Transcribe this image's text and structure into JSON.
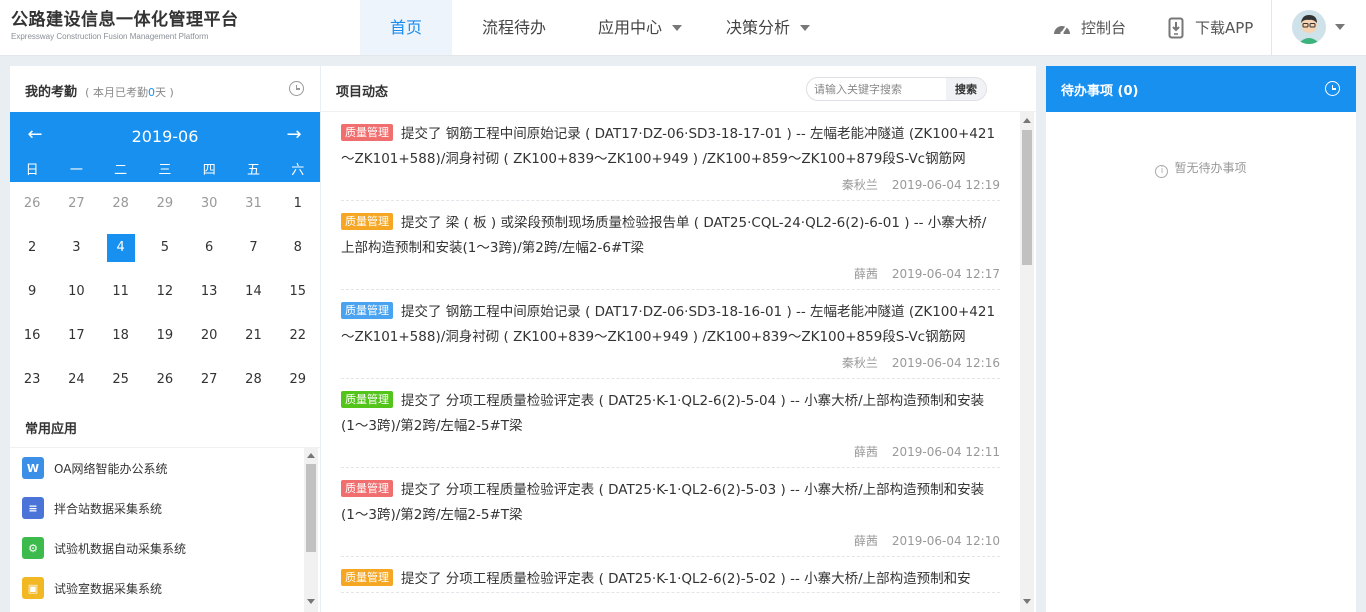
{
  "brand": {
    "title_cn": "公路建设信息一体化管理平台",
    "title_en": "Expressway Construction Fusion Management Platform"
  },
  "nav": [
    {
      "label": "首页",
      "active": true
    },
    {
      "label": "流程待办"
    },
    {
      "label": "应用中心",
      "dropdown": true
    },
    {
      "label": "决策分析",
      "dropdown": true
    }
  ],
  "header_right": {
    "console_label": "控制台",
    "download_label": "下载APP"
  },
  "attendance": {
    "title": "我的考勤",
    "subtitle_prefix": "( 本月已考勤",
    "count": "0",
    "subtitle_suffix": "天 )"
  },
  "calendar": {
    "month": "2019-06",
    "prev_icon": "←",
    "next_icon": "→",
    "weekdays": [
      "日",
      "一",
      "二",
      "三",
      "四",
      "五",
      "六"
    ],
    "weeks": [
      [
        {
          "d": "26",
          "muted": true
        },
        {
          "d": "27",
          "muted": true
        },
        {
          "d": "28",
          "muted": true
        },
        {
          "d": "29",
          "muted": true
        },
        {
          "d": "30",
          "muted": true
        },
        {
          "d": "31",
          "muted": true
        },
        {
          "d": "1"
        }
      ],
      [
        {
          "d": "2"
        },
        {
          "d": "3"
        },
        {
          "d": "4",
          "today": true
        },
        {
          "d": "5"
        },
        {
          "d": "6"
        },
        {
          "d": "7"
        },
        {
          "d": "8"
        }
      ],
      [
        {
          "d": "9"
        },
        {
          "d": "10"
        },
        {
          "d": "11"
        },
        {
          "d": "12"
        },
        {
          "d": "13"
        },
        {
          "d": "14"
        },
        {
          "d": "15"
        }
      ],
      [
        {
          "d": "16"
        },
        {
          "d": "17"
        },
        {
          "d": "18"
        },
        {
          "d": "19"
        },
        {
          "d": "20"
        },
        {
          "d": "21"
        },
        {
          "d": "22"
        }
      ],
      [
        {
          "d": "23"
        },
        {
          "d": "24"
        },
        {
          "d": "25"
        },
        {
          "d": "26"
        },
        {
          "d": "27"
        },
        {
          "d": "28"
        },
        {
          "d": "29"
        }
      ]
    ]
  },
  "apps": {
    "title": "常用应用",
    "items": [
      {
        "label": "OA网络智能办公系统",
        "icon": "oa-icon",
        "color": "#3b8fe6"
      },
      {
        "label": "拌合站数据采集系统",
        "icon": "database-icon",
        "color": "#4b74d8"
      },
      {
        "label": "试验机数据自动采集系统",
        "icon": "gear-icon",
        "color": "#3cba4b"
      },
      {
        "label": "试验室数据采集系统",
        "icon": "lab-icon",
        "color": "#f2b824"
      }
    ]
  },
  "feed": {
    "title": "项目动态",
    "search_placeholder": "请输入关键字搜索",
    "search_button": "搜索",
    "items": [
      {
        "tag": "质量管理",
        "tag_color": "#f06e6e",
        "text": "提交了 钢筋工程中间原始记录 ( DAT17·DZ-06·SD3-18-17-01 ) -- 左幅老能冲隧道 (ZK100+421～ZK101+588)/洞身衬砌 ( ZK100+839～ZK100+949 ) /ZK100+859～ZK100+879段S-Vc钢筋网",
        "user": "秦秋兰",
        "time": "2019-06-04 12:19"
      },
      {
        "tag": "质量管理",
        "tag_color": "#f5a623",
        "text": "提交了 梁 ( 板 ) 或梁段预制现场质量检验报告单 ( DAT25·CQL-24·QL2-6(2)-6-01 ) -- 小寨大桥/上部构造预制和安装(1～3跨)/第2跨/左幅2-6#T梁",
        "user": "薛茜",
        "time": "2019-06-04 12:17"
      },
      {
        "tag": "质量管理",
        "tag_color": "#4aa3f0",
        "text": "提交了 钢筋工程中间原始记录 ( DAT17·DZ-06·SD3-18-16-01 ) -- 左幅老能冲隧道 (ZK100+421～ZK101+588)/洞身衬砌 ( ZK100+839～ZK100+949 ) /ZK100+839～ZK100+859段S-Vc钢筋网",
        "user": "秦秋兰",
        "time": "2019-06-04 12:16"
      },
      {
        "tag": "质量管理",
        "tag_color": "#52c41a",
        "text": "提交了 分项工程质量检验评定表 ( DAT25·K-1·QL2-6(2)-5-04 ) -- 小寨大桥/上部构造预制和安装(1～3跨)/第2跨/左幅2-5#T梁",
        "user": "薛茜",
        "time": "2019-06-04 12:11"
      },
      {
        "tag": "质量管理",
        "tag_color": "#f06e6e",
        "text": "提交了 分项工程质量检验评定表 ( DAT25·K-1·QL2-6(2)-5-03 ) -- 小寨大桥/上部构造预制和安装(1～3跨)/第2跨/左幅2-5#T梁",
        "user": "薛茜",
        "time": "2019-06-04 12:10"
      },
      {
        "tag": "质量管理",
        "tag_color": "#f5a623",
        "text": "提交了 分项工程质量检验评定表 ( DAT25·K-1·QL2-6(2)-5-02 ) -- 小寨大桥/上部构造预制和安",
        "user": "",
        "time": ""
      }
    ]
  },
  "todo": {
    "title": "待办事项 (0)",
    "empty_text": "暂无待办事项"
  }
}
